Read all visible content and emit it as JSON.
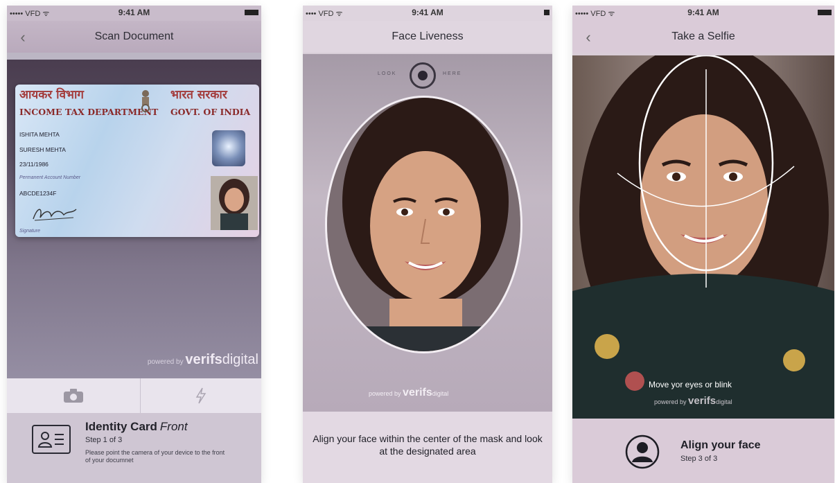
{
  "phones": [
    {
      "status": {
        "carrier": "••••• VFD ᯤ",
        "time": "9:41 AM"
      },
      "title": "Scan Document",
      "card": {
        "hindi_left": "आयकर विभाग",
        "hindi_right": "भारत सरकार",
        "dept": "INCOME TAX DEPARTMENT",
        "govt": "GOVT. OF INDIA",
        "name": "ISHITA MEHTA",
        "father_name": "SURESH MEHTA",
        "dob": "23/11/1986",
        "pan_label": "Permanent Account Number",
        "pan": "ABCDE1234F",
        "signature_label": "Signature"
      },
      "powered_by": "powered by",
      "brand": "verifs",
      "brand2": "digital",
      "doc_title": "Identity Card",
      "doc_side": "Front",
      "step": "Step 1 of 3",
      "description": "Please point the camera of your device to the front of your documnet"
    },
    {
      "status": {
        "carrier": "•••• VFD ᯤ",
        "time": "9:41 AM"
      },
      "title": "Face Liveness",
      "look": "LOOK",
      "here": "HERE",
      "powered_by": "powered by",
      "brand": "verifs",
      "brand2": "digital",
      "instruction": "Align your face within the center of the mask and look at the designated area"
    },
    {
      "status": {
        "carrier": "••••• VFD ᯤ",
        "time": "9:41 AM"
      },
      "title": "Take a Selfie",
      "message": "Move yor eyes or blink",
      "powered_by": "powered by",
      "brand": "verifs",
      "brand2": "digital",
      "align_title": "Align your face",
      "step": "Step 3 of 3"
    }
  ],
  "icons": {
    "back": "chevron-left-icon",
    "camera": "camera-icon",
    "flash": "flash-icon",
    "id_card": "id-card-icon",
    "user": "user-avatar-icon"
  },
  "colors": {
    "bg": "#ffffff",
    "text_dark": "#22222a",
    "card_red": "#a33b3b",
    "panel": "#cfc6d3"
  }
}
